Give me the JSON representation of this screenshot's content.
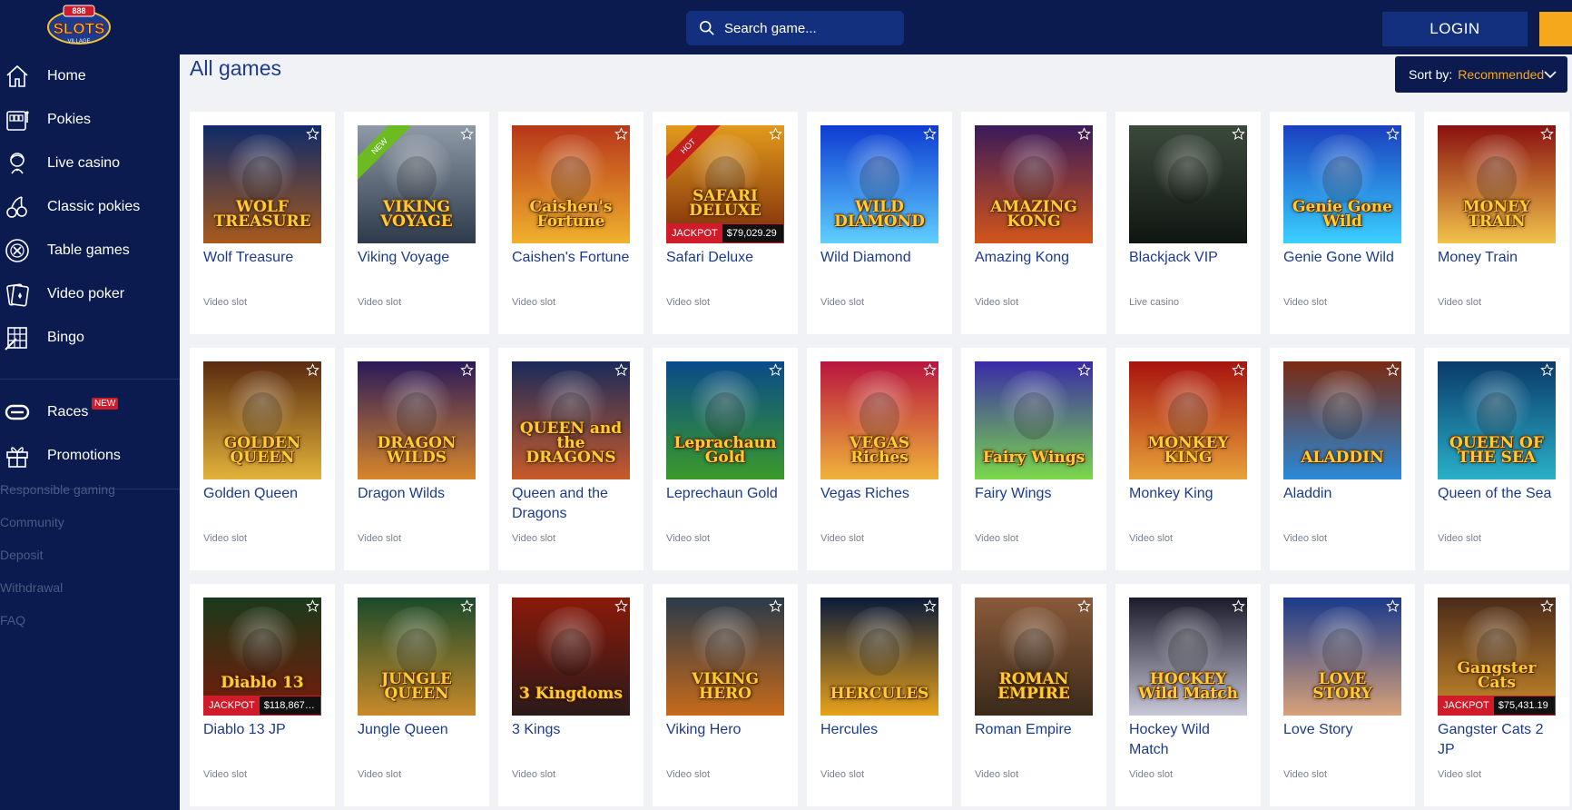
{
  "header": {
    "logo_text": "888 SLOTS VILLAGE",
    "search_placeholder": "Search game...",
    "login_label": "LOGIN"
  },
  "sidebar": {
    "items": [
      {
        "label": "Home",
        "icon": "home-icon"
      },
      {
        "label": "Pokies",
        "icon": "slot-machine-icon"
      },
      {
        "label": "Live casino",
        "icon": "dealer-icon"
      },
      {
        "label": "Classic pokies",
        "icon": "cherries-icon"
      },
      {
        "label": "Table games",
        "icon": "roulette-icon"
      },
      {
        "label": "Video poker",
        "icon": "cards-icon"
      },
      {
        "label": "Bingo",
        "icon": "bingo-card-icon"
      },
      {
        "label": "Races",
        "icon": "races-icon",
        "badge": "NEW"
      },
      {
        "label": "Promotions",
        "icon": "gift-icon"
      }
    ],
    "links": [
      "Responsible gaming",
      "Community",
      "Deposit",
      "Withdrawal",
      "FAQ"
    ]
  },
  "main": {
    "title": "All games",
    "sort_label": "Sort by:",
    "sort_value": "Recommended"
  },
  "games": [
    {
      "name": "Wolf Treasure",
      "category": "Video slot",
      "art_title": "WOLF TREASURE",
      "c1": "#0f2a6a",
      "c2": "#a85a1c"
    },
    {
      "name": "Viking Voyage",
      "category": "Video slot",
      "art_title": "VIKING VOYAGE",
      "ribbon": "NEW",
      "c1": "#8f9aa7",
      "c2": "#2d3a4a"
    },
    {
      "name": "Caishen's Fortune",
      "category": "Video slot",
      "art_title": "Caishen's Fortune",
      "c1": "#b7361a",
      "c2": "#f0b12c"
    },
    {
      "name": "Safari Deluxe",
      "category": "Video slot",
      "art_title": "SAFARI DELUXE",
      "ribbon": "HOT",
      "jackpot_label": "JACKPOT",
      "jackpot": "$79,029.29",
      "c1": "#e29a1b",
      "c2": "#7a2a0a"
    },
    {
      "name": "Wild Diamond",
      "category": "Video slot",
      "art_title": "WILD DIAMOND",
      "c1": "#0d3bd1",
      "c2": "#5fd0ff"
    },
    {
      "name": "Amazing Kong",
      "category": "Video slot",
      "art_title": "AMAZING KONG",
      "c1": "#3a1a5a",
      "c2": "#d2551a"
    },
    {
      "name": "Blackjack VIP",
      "category": "Live casino",
      "art_title": "",
      "c1": "#3b4a3b",
      "c2": "#101612"
    },
    {
      "name": "Genie Gone Wild",
      "category": "Video slot",
      "art_title": "Genie Gone Wild",
      "c1": "#1a3fbf",
      "c2": "#3ad0ff"
    },
    {
      "name": "Money Train",
      "category": "Video slot",
      "art_title": "MONEY TRAIN",
      "c1": "#8a1010",
      "c2": "#f1c24a"
    },
    {
      "name": "Golden Queen",
      "category": "Video slot",
      "art_title": "GOLDEN QUEEN",
      "c1": "#5a2a10",
      "c2": "#e2b33a"
    },
    {
      "name": "Dragon Wilds",
      "category": "Video slot",
      "art_title": "DRAGON WILDS",
      "c1": "#2a1a5a",
      "c2": "#d8862a"
    },
    {
      "name": "Queen and the Dragons",
      "category": "Video slot",
      "art_title": "QUEEN and the DRAGONS",
      "c1": "#1a2a5a",
      "c2": "#c85a2a"
    },
    {
      "name": "Leprechaun Gold",
      "category": "Video slot",
      "art_title": "Leprachaun Gold",
      "c1": "#0a4a8a",
      "c2": "#3a9a2a"
    },
    {
      "name": "Vegas Riches",
      "category": "Video slot",
      "art_title": "VEGAS Riches",
      "c1": "#b8153f",
      "c2": "#f0b33a"
    },
    {
      "name": "Fairy Wings",
      "category": "Video slot",
      "art_title": "Fairy Wings",
      "c1": "#3a2aa8",
      "c2": "#7ad84a"
    },
    {
      "name": "Monkey King",
      "category": "Video slot",
      "art_title": "MONKEY KING",
      "c1": "#a8130f",
      "c2": "#e8a23a"
    },
    {
      "name": "Aladdin",
      "category": "Video slot",
      "art_title": "ALADDIN",
      "c1": "#7a2a10",
      "c2": "#2a8ad8"
    },
    {
      "name": "Queen of the Sea",
      "category": "Video slot",
      "art_title": "QUEEN OF THE SEA",
      "c1": "#0a3a6a",
      "c2": "#2ab0c8"
    },
    {
      "name": "Diablo 13 JP",
      "category": "Video slot",
      "art_title": "Diablo 13",
      "jackpot_label": "JACKPOT",
      "jackpot": "$118,867....",
      "c1": "#1a3a1a",
      "c2": "#7a1a0a"
    },
    {
      "name": "Jungle Queen",
      "category": "Video slot",
      "art_title": "JUNGLE QUEEN",
      "c1": "#1a4a2a",
      "c2": "#c88a2a"
    },
    {
      "name": "3 Kings",
      "category": "Video slot",
      "art_title": "3 Kingdoms",
      "c1": "#8a1a0a",
      "c2": "#2a1a1a"
    },
    {
      "name": "Viking Hero",
      "category": "Video slot",
      "art_title": "VIKING HERO",
      "c1": "#2a3a4a",
      "c2": "#c86a1a"
    },
    {
      "name": "Hercules",
      "category": "Video slot",
      "art_title": "HERCULES",
      "c1": "#0a1a3a",
      "c2": "#e8a21a"
    },
    {
      "name": "Roman Empire",
      "category": "Video slot",
      "art_title": "ROMAN EMPIRE",
      "c1": "#8a5a3a",
      "c2": "#3a2a1a"
    },
    {
      "name": "Hockey Wild Match",
      "category": "Video slot",
      "art_title": "HOCKEY Wild Match",
      "c1": "#1a1a2a",
      "c2": "#c8c8d8"
    },
    {
      "name": "Love Story",
      "category": "Video slot",
      "art_title": "LOVE STORY",
      "c1": "#1a3a8a",
      "c2": "#d8a27a"
    },
    {
      "name": "Gangster Cats 2 JP",
      "category": "Video slot",
      "art_title": "Gangster Cats",
      "jackpot_label": "JACKPOT",
      "jackpot": "$75,431.19",
      "c1": "#4a2a1a",
      "c2": "#c88a2a"
    }
  ]
}
